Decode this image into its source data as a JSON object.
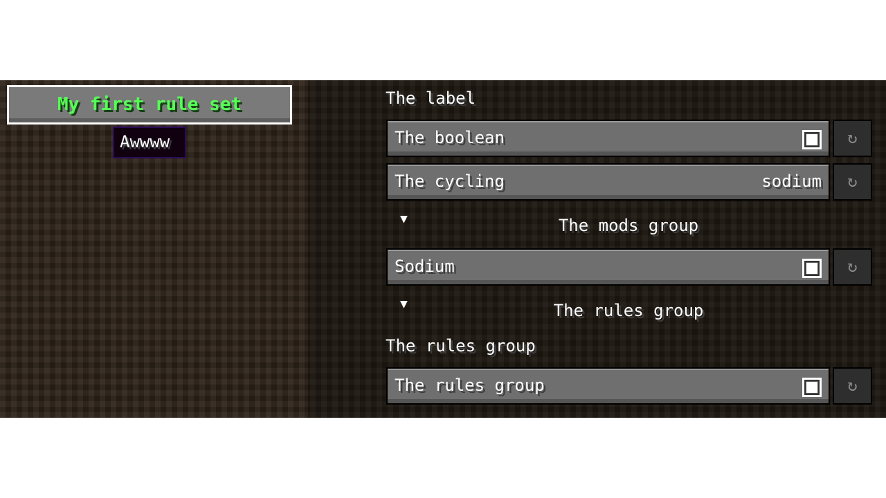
{
  "rule_set": {
    "title": "My first rule set",
    "tooltip": "Awwww",
    "title_color": "#55ff55"
  },
  "label_section": "The label",
  "rows": [
    {
      "label": "The boolean",
      "type": "checkbox",
      "checked": true
    },
    {
      "label": "The cycling",
      "type": "cycling",
      "value": "sodium"
    }
  ],
  "mods_group": {
    "title": "The mods group",
    "expand_icon": "arrow-down-icon",
    "rows": [
      {
        "label": "Sodium",
        "type": "checkbox",
        "checked": true
      }
    ]
  },
  "rules_group_header": {
    "title": "The rules group",
    "expand_icon": "arrow-down-icon"
  },
  "rules_group_label": "The rules group",
  "rules_group_rows": [
    {
      "label": "The rules group",
      "type": "checkbox",
      "checked": true
    }
  ],
  "reset_icon": "reset-icon",
  "reset_glyph": "↻"
}
